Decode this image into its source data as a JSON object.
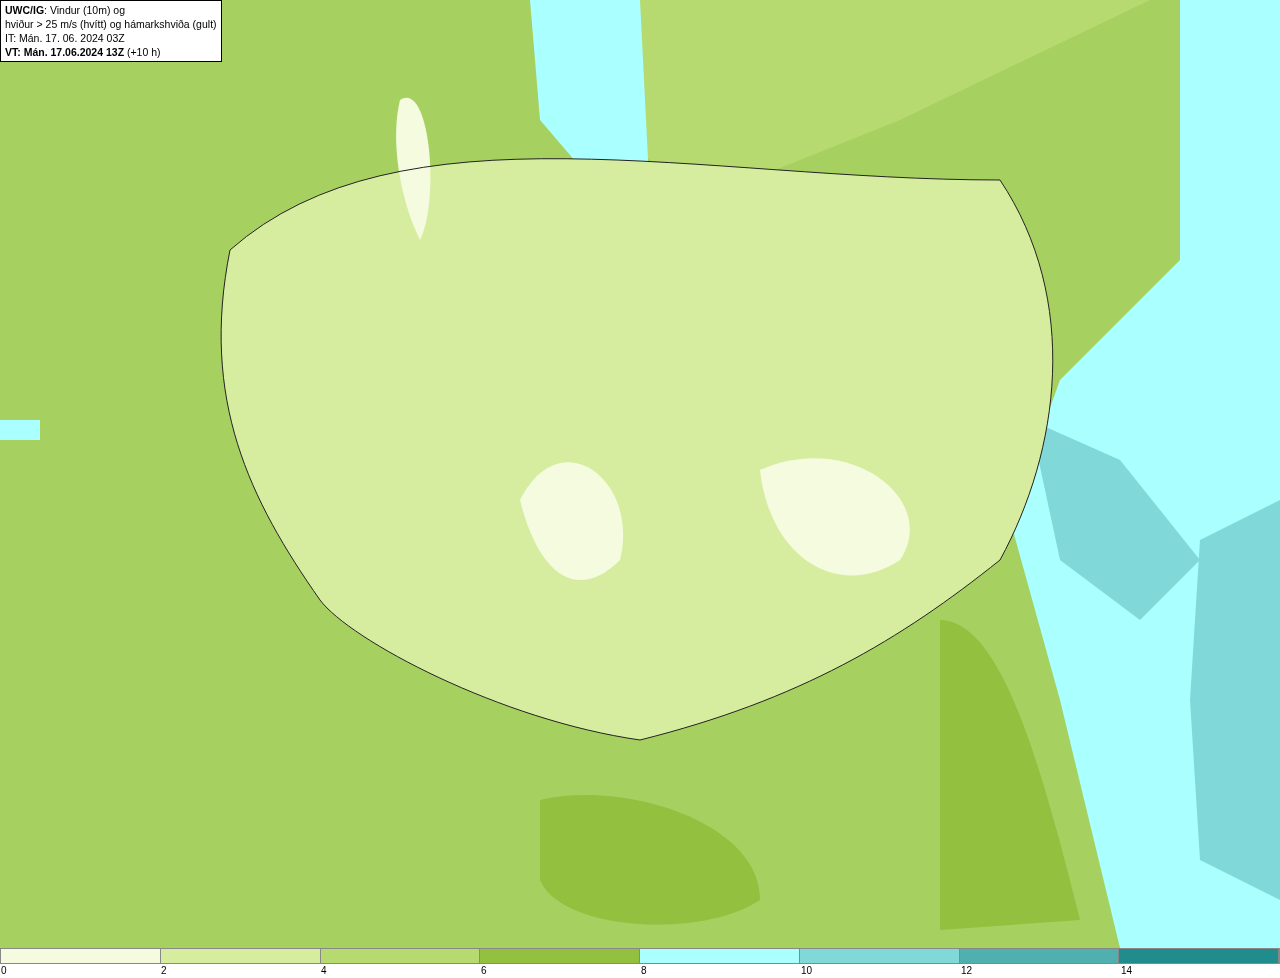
{
  "legend": {
    "lines": [
      "**UWC/IG**: Vindur (10m) og",
      "hviður > 25 m/s (hvítt) og hámarkshviða (gult)",
      "IT: Mán. 17. 06. 2024 03Z",
      "**VT: Mán. 17.06.2024 13Z** (+10 h)"
    ]
  },
  "colorbar": {
    "segments": [
      {
        "color": "#f4fbdf"
      },
      {
        "color": "#d6eda0"
      },
      {
        "color": "#b6da70"
      },
      {
        "color": "#94c040"
      },
      {
        "color": "#aaffff"
      },
      {
        "color": "#80d8d8"
      },
      {
        "color": "#50b0b0"
      },
      {
        "color": "#208c8c"
      }
    ],
    "ticks": [
      "0",
      "2",
      "4",
      "6",
      "8",
      "10",
      "12",
      "14"
    ]
  }
}
